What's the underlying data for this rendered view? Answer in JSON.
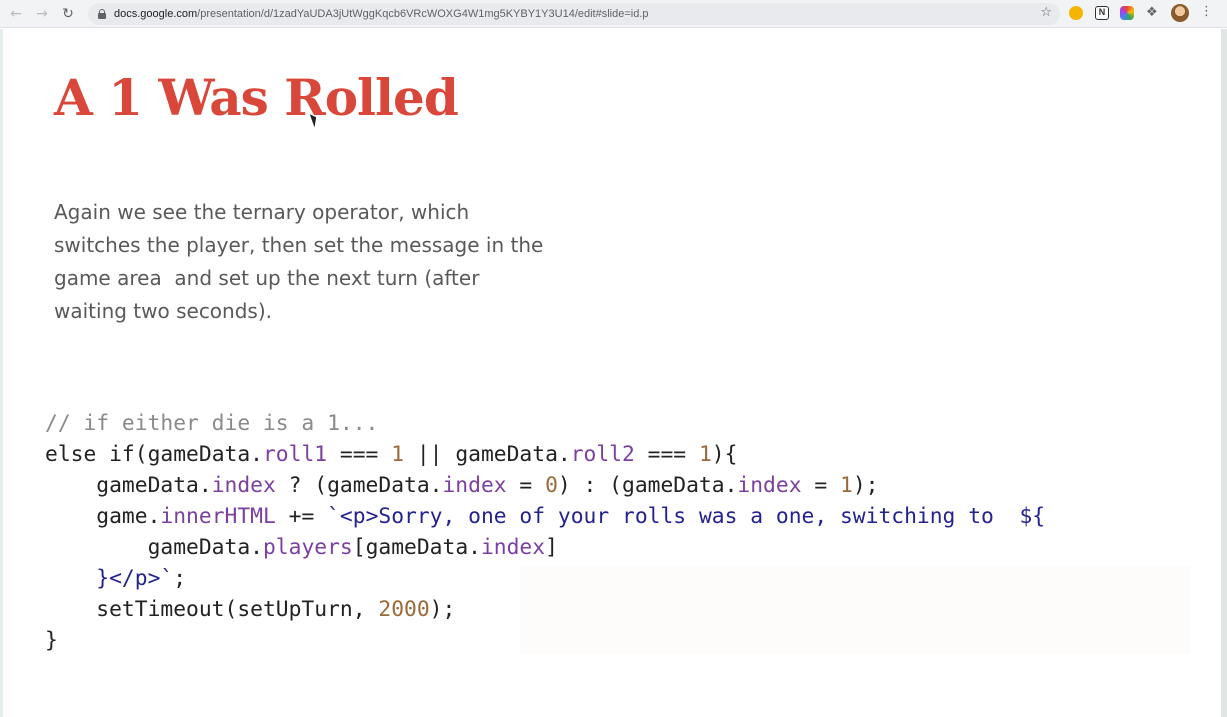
{
  "browser": {
    "back_icon": "arrow-left-icon",
    "forward_icon": "arrow-right-icon",
    "reload_icon": "reload-icon",
    "url_host": "docs.google.com",
    "url_path": "/presentation/d/1zadYaUDA3jUtWggKqcb6VRcWOXG4W1mg5KYBY1Y3U14/edit#slide=id.p",
    "bookmark_icon": "star-icon",
    "extensions": [
      "yellow-circle-extension-icon",
      "notion-extension-icon",
      "color-extension-icon",
      "puzzle-icon"
    ],
    "notion_glyph": "N",
    "menu_icon": "vertical-dots-icon"
  },
  "slide": {
    "title": "A 1 Was Rolled",
    "title_color": "#d9473a",
    "body_lines": [
      "Again we see the ternary operator, which",
      "switches the player, then set the message in the",
      "game area  and set up the next turn (after",
      "waiting two seconds)."
    ],
    "code": [
      [
        {
          "t": "comment",
          "v": "// if either die is a 1..."
        }
      ],
      [
        {
          "t": "kw",
          "v": "else if"
        },
        {
          "t": "plain",
          "v": "(gameData."
        },
        {
          "t": "prop",
          "v": "roll1"
        },
        {
          "t": "plain",
          "v": " === "
        },
        {
          "t": "num",
          "v": "1"
        },
        {
          "t": "plain",
          "v": " || gameData."
        },
        {
          "t": "prop",
          "v": "roll2"
        },
        {
          "t": "plain",
          "v": " === "
        },
        {
          "t": "num",
          "v": "1"
        },
        {
          "t": "plain",
          "v": "){"
        }
      ],
      [
        {
          "t": "plain",
          "v": "    gameData."
        },
        {
          "t": "prop",
          "v": "index"
        },
        {
          "t": "plain",
          "v": " ? (gameData."
        },
        {
          "t": "prop",
          "v": "index"
        },
        {
          "t": "plain",
          "v": " = "
        },
        {
          "t": "num",
          "v": "0"
        },
        {
          "t": "plain",
          "v": ") : (gameData."
        },
        {
          "t": "prop",
          "v": "index"
        },
        {
          "t": "plain",
          "v": " = "
        },
        {
          "t": "num",
          "v": "1"
        },
        {
          "t": "plain",
          "v": ");"
        }
      ],
      [
        {
          "t": "plain",
          "v": "    game."
        },
        {
          "t": "prop",
          "v": "innerHTML"
        },
        {
          "t": "plain",
          "v": " += "
        },
        {
          "t": "str",
          "v": "`<p>Sorry, one of your rolls was a one, switching to  ${"
        }
      ],
      [
        {
          "t": "plain",
          "v": "        gameData."
        },
        {
          "t": "prop",
          "v": "players"
        },
        {
          "t": "plain",
          "v": "[gameData."
        },
        {
          "t": "prop",
          "v": "index"
        },
        {
          "t": "plain",
          "v": "]"
        }
      ],
      [
        {
          "t": "str",
          "v": "    }</p>`"
        },
        {
          "t": "plain",
          "v": ";"
        }
      ],
      [
        {
          "t": "plain",
          "v": "    setTimeout(setUpTurn, "
        },
        {
          "t": "num",
          "v": "2000"
        },
        {
          "t": "plain",
          "v": ");"
        }
      ],
      [
        {
          "t": "plain",
          "v": "}"
        }
      ]
    ]
  }
}
